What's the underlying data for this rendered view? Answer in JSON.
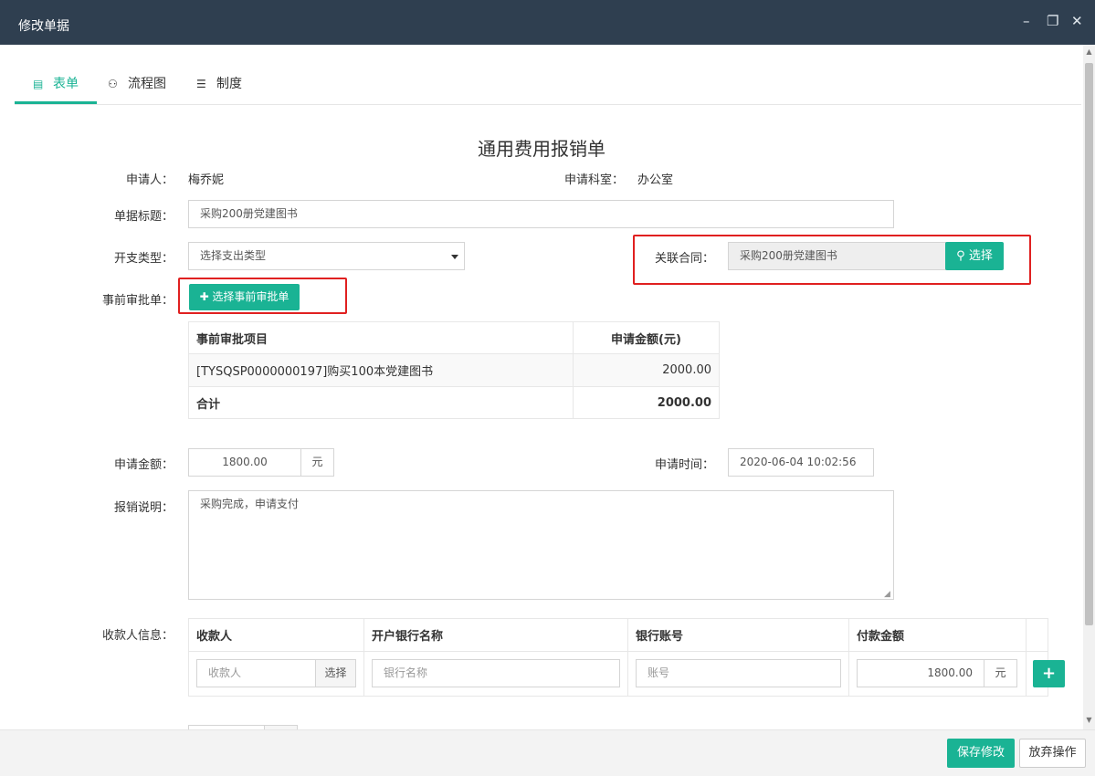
{
  "window": {
    "title": "修改单据",
    "minimize": "–",
    "maximize": "❐",
    "close": "✕"
  },
  "tabs": [
    {
      "label": "表单",
      "icon": "form-icon"
    },
    {
      "label": "流程图",
      "icon": "sitemap-icon"
    },
    {
      "label": "制度",
      "icon": "list-icon"
    }
  ],
  "form": {
    "title": "通用费用报销单",
    "applicant_label": "申请人：",
    "applicant": "梅乔妮",
    "dept_label": "申请科室：",
    "dept": "办公室",
    "doc_title_label": "单据标题：",
    "doc_title": "采购200册党建图书",
    "expense_type_label": "开支类型：",
    "expense_type": "选择支出类型",
    "contract_label": "关联合同：",
    "contract": "采购200册党建图书",
    "contract_btn": "选择",
    "preapproval_label": "事前审批单：",
    "preapproval_btn": "✚ 选择事前审批单",
    "preapproval_table": {
      "headers": [
        "事前审批项目",
        "申请金额(元)"
      ],
      "rows": [
        [
          "[TYSQSP0000000197]购买100本党建图书",
          "2000.00"
        ]
      ],
      "total_label": "合计",
      "total": "2000.00"
    },
    "amount_label": "申请金额：",
    "amount": "1800.00",
    "amount_unit": "元",
    "time_label": "申请时间：",
    "time": "2020-06-04 10:02:56",
    "desc_label": "报销说明：",
    "desc": "采购完成，申请支付",
    "payee_label": "收款人信息：",
    "payee_table": {
      "headers": [
        "收款人",
        "开户银行名称",
        "银行账号",
        "付款金额"
      ],
      "payee_placeholder": "收款人",
      "payee_btn": "选择",
      "bank_placeholder": "银行名称",
      "account_placeholder": "账号",
      "pay_amount": "1800.00",
      "pay_unit": "元",
      "add_btn": "+"
    }
  },
  "footer": {
    "save": "保存修改",
    "discard": "放弃操作"
  },
  "colors": {
    "accent": "#1ab394",
    "titlebar": "#2f3f50",
    "highlight": "#e02020"
  }
}
